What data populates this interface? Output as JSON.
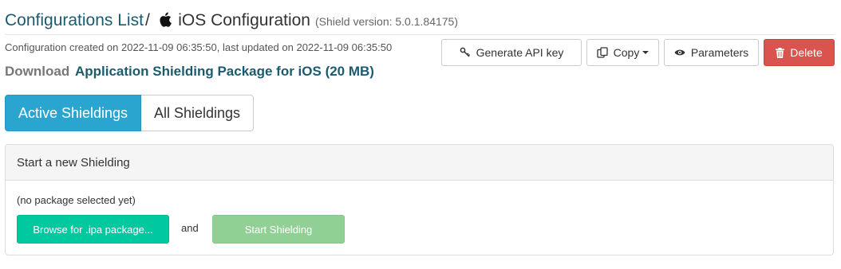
{
  "header": {
    "breadcrumb_link": "Configurations List",
    "separator": "/",
    "title": "iOS Configuration",
    "version": "(Shield version: 5.0.1.84175)",
    "platform_icon": "apple-icon"
  },
  "meta": {
    "created_updated": "Configuration created on 2022-11-09 06:35:50, last updated on 2022-11-09 06:35:50"
  },
  "download": {
    "label": "Download",
    "link_text": "Application Shielding Package for iOS (20 MB)"
  },
  "toolbar": {
    "api_key_label": "Generate API key",
    "api_key_icon": "key-icon",
    "copy_label": "Copy",
    "copy_icon": "copy-icon",
    "parameters_label": "Parameters",
    "parameters_icon": "eye-icon",
    "delete_label": "Delete",
    "delete_icon": "trash-icon"
  },
  "tabs": [
    {
      "label": "Active Shieldings",
      "active": true
    },
    {
      "label": "All Shieldings",
      "active": false
    }
  ],
  "panel": {
    "heading": "Start a new Shielding",
    "no_package": "(no package selected yet)",
    "browse_label": "Browse for .ipa package...",
    "and_text": "and",
    "start_label": "Start Shielding"
  },
  "colors": {
    "link": "#1c5b6e",
    "tab_active": "#2aa5cf",
    "delete": "#d9534f",
    "browse": "#00c9a0",
    "start_disabled": "#91d095"
  }
}
